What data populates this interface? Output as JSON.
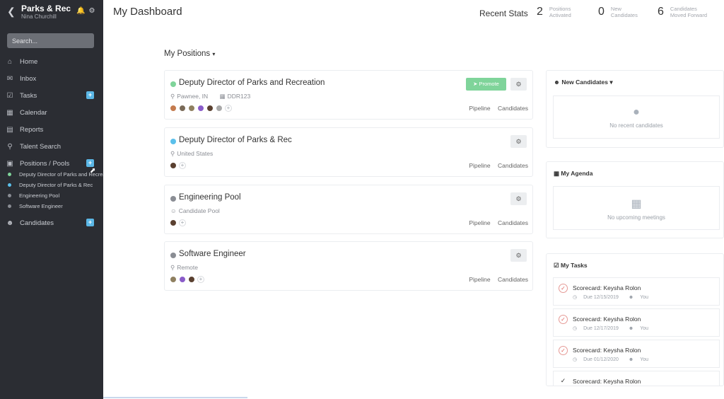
{
  "sidebar": {
    "org_name": "Parks & Rec",
    "user_name": "Nina Churchill",
    "search_placeholder": "Search...",
    "items": [
      {
        "label": "Home",
        "icon": "home-icon"
      },
      {
        "label": "Inbox",
        "icon": "mail-icon"
      },
      {
        "label": "Tasks",
        "icon": "checkbox-icon",
        "plus": "+"
      },
      {
        "label": "Calendar",
        "icon": "calendar-icon"
      },
      {
        "label": "Reports",
        "icon": "bar-chart-icon"
      },
      {
        "label": "Talent Search",
        "icon": "search-icon"
      },
      {
        "label": "Positions / Pools",
        "icon": "briefcase-icon",
        "plus": "+"
      },
      {
        "label": "Candidates",
        "icon": "users-icon",
        "plus": "+"
      }
    ],
    "positions": [
      {
        "label": "Deputy Director of Parks and Recreation",
        "color": "#7fd49a"
      },
      {
        "label": "Deputy Director of Parks & Rec",
        "color": "#5bc0eb"
      },
      {
        "label": "Engineering Pool",
        "color": "#8a8d94"
      },
      {
        "label": "Software Engineer",
        "color": "#8a8d94"
      }
    ]
  },
  "header": {
    "title": "My Dashboard",
    "stats_label": "Recent Stats",
    "stats": [
      {
        "value": "2",
        "label": "Positions\nActivated"
      },
      {
        "value": "0",
        "label": "New\nCandidates"
      },
      {
        "value": "6",
        "label": "Candidates\nMoved Forward"
      }
    ]
  },
  "positions_section": {
    "title": "My Positions",
    "cards": [
      {
        "title": "Deputy Director of Parks and Recreation",
        "dot_color": "#7fd49a",
        "location": "Pawnee, IN",
        "code": "DDR123",
        "promote_label": "Promote",
        "pipeline_label": "Pipeline",
        "candidates_label": "Candidates"
      },
      {
        "title": "Deputy Director of Parks & Rec",
        "dot_color": "#5bc0eb",
        "location": "United States",
        "pipeline_label": "Pipeline",
        "candidates_label": "Candidates"
      },
      {
        "title": "Engineering Pool",
        "dot_color": "#8a8d94",
        "location": "Candidate Pool",
        "pipeline_label": "Pipeline",
        "candidates_label": "Candidates"
      },
      {
        "title": "Software Engineer",
        "dot_color": "#8a8d94",
        "location": "Remote",
        "pipeline_label": "Pipeline",
        "candidates_label": "Candidates"
      }
    ]
  },
  "new_candidates": {
    "title": "New Candidates",
    "empty_text": "No recent candidates"
  },
  "agenda": {
    "title": "My Agenda",
    "empty_text": "No upcoming meetings"
  },
  "tasks": {
    "title": "My Tasks",
    "items": [
      {
        "name": "Scorecard: Keysha Rolon",
        "due": "Due 12/15/2019",
        "assignee": "You"
      },
      {
        "name": "Scorecard: Keysha Rolon",
        "due": "Due 12/17/2019",
        "assignee": "You"
      },
      {
        "name": "Scorecard: Keysha Rolon",
        "due": "Due 01/12/2020",
        "assignee": "You"
      },
      {
        "name": "Scorecard: Keysha Rolon",
        "due": "",
        "assignee": ""
      }
    ]
  },
  "colors": {
    "sidebar_bg": "#2b2d33",
    "accent": "#5bb7e6",
    "promote": "#7fd49a"
  }
}
